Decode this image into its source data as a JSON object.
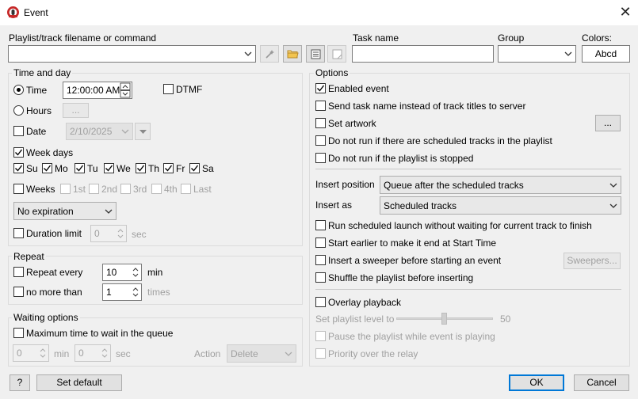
{
  "window": {
    "title": "Event",
    "close_glyph": "✕"
  },
  "header": {
    "filename_label": "Playlist/track filename or command",
    "filename_value": "",
    "task_name_label": "Task name",
    "task_name_value": "",
    "group_label": "Group",
    "group_value": "",
    "colors_label": "Colors:",
    "colors_value": "Abcd"
  },
  "time_and_day": {
    "group_label": "Time and day",
    "time_label": "Time",
    "time_value": "12:00:00 AM",
    "dtmf_label": "DTMF",
    "hours_label": "Hours",
    "hours_button": "...",
    "date_label": "Date",
    "date_value": "2/10/2025",
    "week_days_label": "Week days",
    "days": [
      "Su",
      "Mo",
      "Tu",
      "We",
      "Th",
      "Fr",
      "Sa"
    ],
    "weeks_label": "Weeks",
    "week_options": [
      "1st",
      "2nd",
      "3rd",
      "4th",
      "Last"
    ],
    "expiration_value": "No expiration",
    "duration_label": "Duration limit",
    "duration_value": "0",
    "duration_unit": "sec"
  },
  "repeat": {
    "group_label": "Repeat",
    "repeat_every_label": "Repeat every",
    "repeat_every_value": "10",
    "repeat_every_unit": "min",
    "no_more_than_label": "no more than",
    "no_more_than_value": "1",
    "no_more_than_unit": "times"
  },
  "waiting": {
    "group_label": "Waiting options",
    "max_wait_label": "Maximum time to wait in the queue",
    "min_value": "0",
    "min_unit": "min",
    "sec_value": "0",
    "sec_unit": "sec",
    "action_label": "Action",
    "action_value": "Delete"
  },
  "options": {
    "group_label": "Options",
    "enabled_event": "Enabled event",
    "send_task_name": "Send task name instead of track titles to server",
    "set_artwork": "Set artwork",
    "artwork_button": "...",
    "no_run_scheduled": "Do not run if there are scheduled tracks in the playlist",
    "no_run_stopped": "Do not run if the playlist is stopped",
    "insert_position_label": "Insert position",
    "insert_position_value": "Queue after the scheduled tracks",
    "insert_as_label": "Insert as",
    "insert_as_value": "Scheduled tracks",
    "run_without_waiting": "Run scheduled launch without waiting for current track to finish",
    "start_earlier": "Start earlier to make it end at Start Time",
    "insert_sweeper": "Insert a sweeper before starting an event",
    "sweepers_button": "Sweepers...",
    "shuffle": "Shuffle the playlist before inserting",
    "overlay": "Overlay playback",
    "playlist_level_label": "Set playlist level to",
    "playlist_level_value": "50",
    "playlist_level_fraction": 0.5,
    "pause_playlist": "Pause the playlist while event is playing",
    "priority_relay": "Priority over the relay"
  },
  "footer": {
    "help_button": "?",
    "set_default_button": "Set default",
    "ok_button": "OK",
    "cancel_button": "Cancel"
  },
  "colors": {
    "accent": "#0078d7",
    "dialog_bg": "#f0f0f0",
    "disabled_text": "#a0a0a0"
  }
}
